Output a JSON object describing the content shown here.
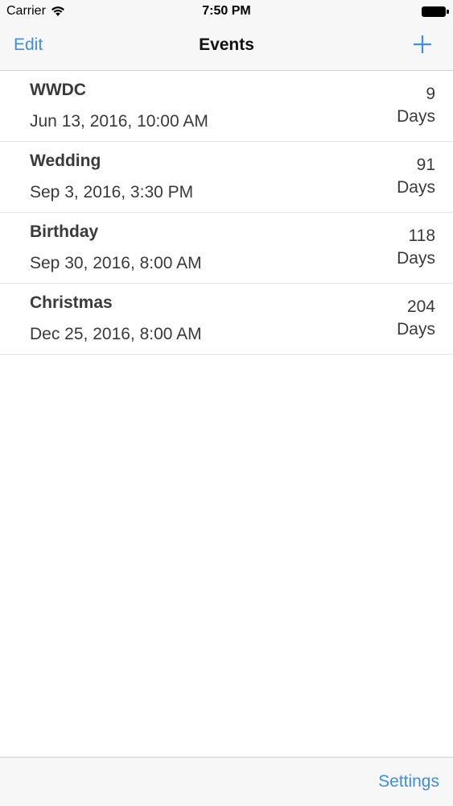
{
  "status_bar": {
    "carrier": "Carrier",
    "time": "7:50 PM"
  },
  "nav": {
    "left_label": "Edit",
    "title": "Events",
    "right_icon": "plus-icon"
  },
  "events": [
    {
      "name": "WWDC",
      "date": "Jun 13, 2016, 10:00 AM",
      "count": "9",
      "unit": "Days"
    },
    {
      "name": "Wedding",
      "date": "Sep 3, 2016, 3:30 PM",
      "count": "91",
      "unit": "Days"
    },
    {
      "name": "Birthday",
      "date": "Sep 30, 2016, 8:00 AM",
      "count": "118",
      "unit": "Days"
    },
    {
      "name": "Christmas",
      "date": "Dec 25, 2016, 8:00 AM",
      "count": "204",
      "unit": "Days"
    }
  ],
  "toolbar": {
    "settings_label": "Settings"
  },
  "colors": {
    "accent": "#3d8fe0",
    "bar_background": "#f7f7f7",
    "text": "#3a3a3a"
  }
}
